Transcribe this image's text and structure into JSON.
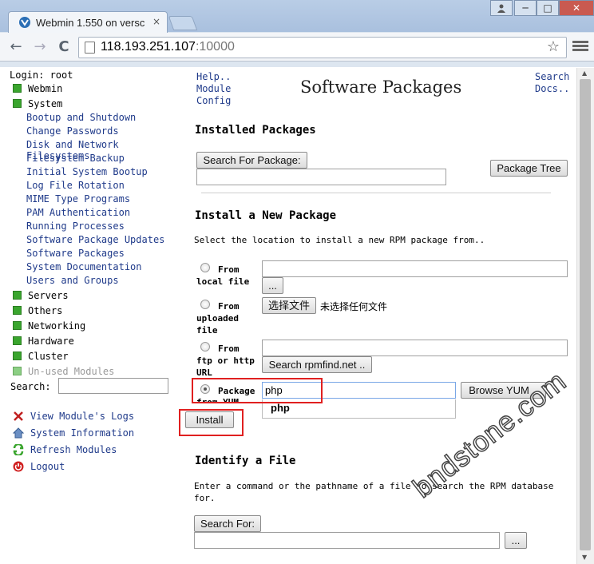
{
  "browser": {
    "tab_title": "Webmin 1.550 on versc",
    "tab_close": "×",
    "url_host": "118.193.251.107",
    "url_port": ":10000",
    "star": "☆",
    "back": "←",
    "forward": "→",
    "reload": "C",
    "minimize": "─",
    "restore": "□",
    "close": "✕",
    "user": "👤"
  },
  "sidebar": {
    "login": "Login: root",
    "categories_top": [
      {
        "label": "Webmin"
      },
      {
        "label": "System"
      }
    ],
    "system_modules": [
      "Bootup and Shutdown",
      "Change Passwords",
      "Disk and Network Filesystems",
      "Filesystem Backup",
      "Initial System Bootup",
      "Log File Rotation",
      "MIME Type Programs",
      "PAM Authentication",
      "Running Processes",
      "Software Package Updates",
      "Software Packages",
      "System Documentation",
      "Users and Groups"
    ],
    "categories_bottom": [
      "Servers",
      "Others",
      "Networking",
      "Hardware",
      "Cluster",
      "Un-used Modules"
    ],
    "search_label": "Search:",
    "actions": [
      "View Module's Logs",
      "System Information",
      "Refresh Modules",
      "Logout"
    ]
  },
  "main": {
    "help": "Help..",
    "module": "Module",
    "config": "Config",
    "search": "Search",
    "docs": "Docs..",
    "title": "Software Packages",
    "installed_heading": "Installed Packages",
    "search_pkg_button": "Search For Package:",
    "package_tree_button": "Package Tree",
    "install_heading": "Install a New Package",
    "install_desc": "Select the location to install a new RPM package from..",
    "from_local_1": "From",
    "from_local_2": "local file",
    "browse_button": "...",
    "from_uploaded_1": "From",
    "from_uploaded_2": "uploaded",
    "from_uploaded_3": "file",
    "choose_file_button": "选择文件",
    "no_file_text": "未选择任何文件",
    "from_ftp_1": "From",
    "from_ftp_2": "ftp or http",
    "from_ftp_3": "URL",
    "rpmfind_button": "Search rpmfind.net ..",
    "yum_1": "Package",
    "yum_2": "from YUM",
    "yum_value": "php",
    "yum_suggestion": "php",
    "browse_yum_button": "Browse YUM ..",
    "install_button": "Install",
    "identify_heading": "Identify a File",
    "identify_desc_1": "Enter a command or the pathname of a file to search the RPM database",
    "identify_desc_2": "for.",
    "search_for_button": "Search For:",
    "identify_browse": "..."
  },
  "watermark": "bndstone.com",
  "colors": {
    "link": "#1f3a8a",
    "highlight": "#e02020",
    "category_box": "#3aa52e"
  }
}
